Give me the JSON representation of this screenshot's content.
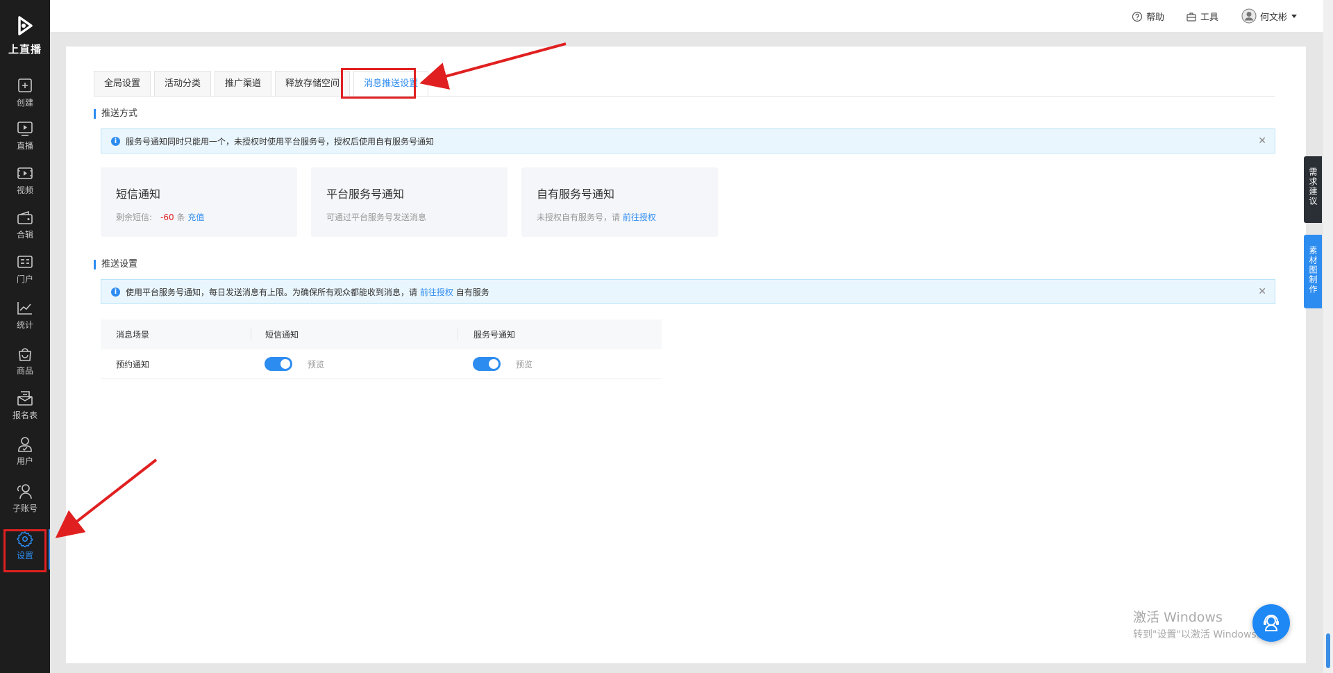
{
  "brand": {
    "name": "上直播"
  },
  "nav": {
    "items": [
      {
        "label": "创建"
      },
      {
        "label": "直播"
      },
      {
        "label": "视频"
      },
      {
        "label": "合辑"
      },
      {
        "label": "门户"
      },
      {
        "label": "统计"
      },
      {
        "label": "商品"
      },
      {
        "label": "报名表"
      },
      {
        "label": "用户"
      },
      {
        "label": "子账号"
      },
      {
        "label": "设置"
      }
    ]
  },
  "header": {
    "help": "帮助",
    "tools": "工具",
    "user": "何文彬"
  },
  "tabs": [
    {
      "label": "全局设置"
    },
    {
      "label": "活动分类"
    },
    {
      "label": "推广渠道"
    },
    {
      "label": "释放存储空间"
    },
    {
      "label": "消息推送设置"
    }
  ],
  "push_method": {
    "title": "推送方式",
    "alert": "服务号通知同时只能用一个，未授权时使用平台服务号，授权后使用自有服务号通知",
    "cards": [
      {
        "title": "短信通知",
        "desc_prefix": "剩余短信:",
        "count": "-60",
        "unit": "条",
        "link": "充值"
      },
      {
        "title": "平台服务号通知",
        "desc": "可通过平台服务号发送消息"
      },
      {
        "title": "自有服务号通知",
        "desc": "未授权自有服务号，请",
        "link": "前往授权"
      }
    ]
  },
  "push_settings": {
    "title": "推送设置",
    "alert_prefix": "使用平台服务号通知，每日发送消息有上限。为确保所有观众都能收到消息，请",
    "alert_link": "前往授权",
    "alert_suffix": "自有服务",
    "columns": [
      "消息场景",
      "短信通知",
      "服务号通知"
    ],
    "rows": [
      {
        "scene": "预约通知",
        "sms_enabled": true,
        "sms_preview": "预览",
        "service_enabled": true,
        "service_preview": "预览"
      }
    ]
  },
  "float": {
    "feedback": "需求建议",
    "material": "素材图制作"
  },
  "watermark": {
    "line1": "激活 Windows",
    "line2": "转到\"设置\"以激活 Windows。"
  },
  "colors": {
    "accent": "#2d8cf0",
    "sidebar": "#1d1d1d",
    "highlight": "#e02020"
  }
}
